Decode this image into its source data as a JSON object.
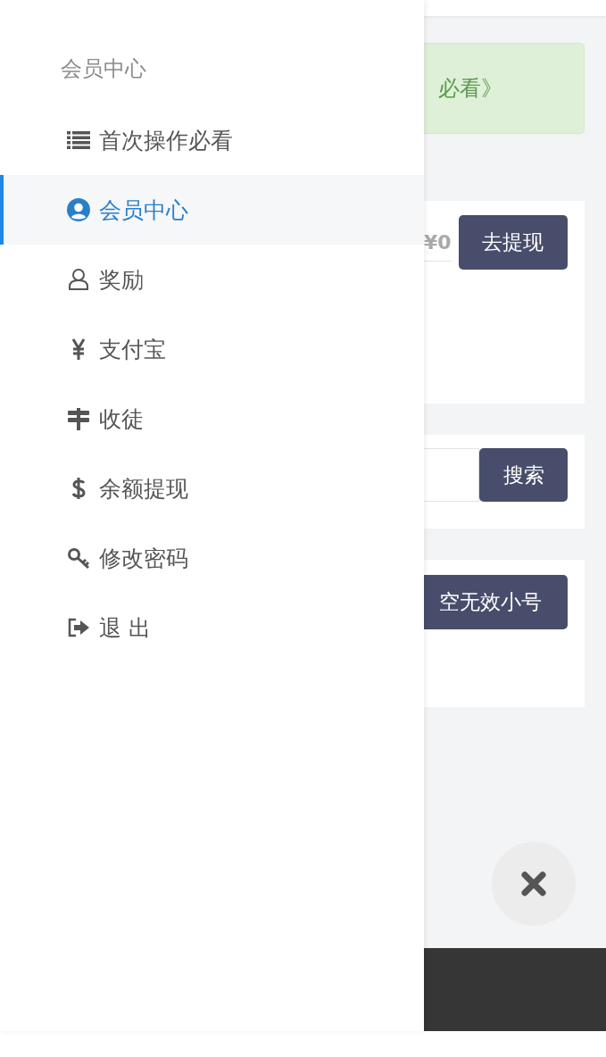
{
  "drawer": {
    "title": "会员中心",
    "items": [
      {
        "label": "首次操作必看",
        "selected": false
      },
      {
        "label": "会员中心",
        "selected": true
      },
      {
        "label": "奖励",
        "selected": false
      },
      {
        "label": "支付宝",
        "selected": false
      },
      {
        "label": "收徒",
        "selected": false
      },
      {
        "label": "余额提现",
        "selected": false
      },
      {
        "label": "修改密码",
        "selected": false
      },
      {
        "label": "退 出",
        "selected": false
      }
    ]
  },
  "notice": {
    "text": "必看》"
  },
  "withdraw_card": {
    "balance": "¥0",
    "button": "去提现"
  },
  "search_card": {
    "button": "搜索"
  },
  "cleanup_card": {
    "button": "空无效小号"
  }
}
